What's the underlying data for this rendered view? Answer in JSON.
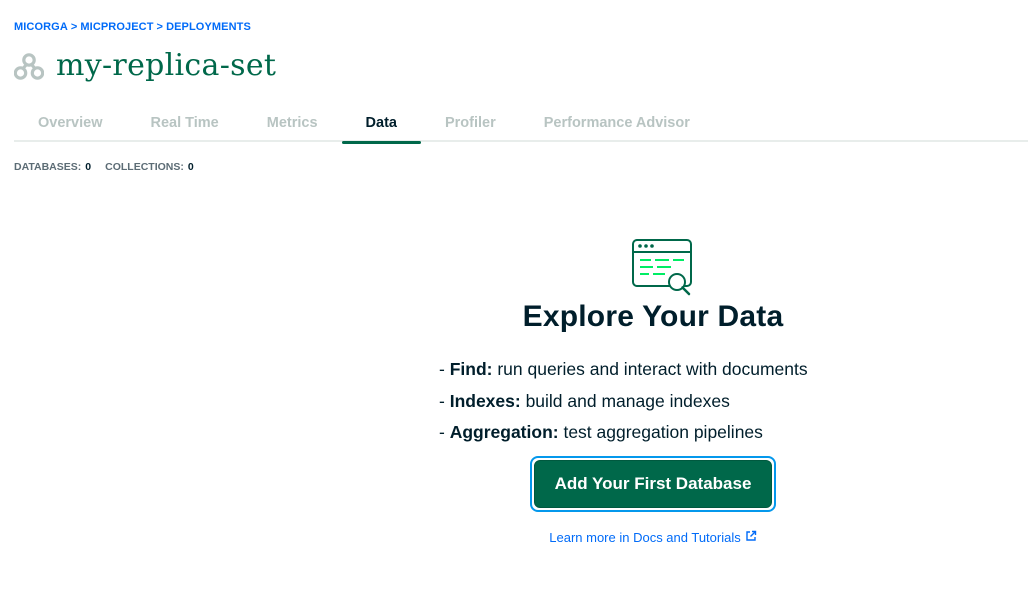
{
  "breadcrumb": {
    "org": "MICORGA",
    "project": "MICPROJECT",
    "section": "DEPLOYMENTS",
    "separator": ">"
  },
  "header": {
    "icon": "replica-set-icon",
    "title": "my-replica-set"
  },
  "tabs": [
    {
      "label": "Overview",
      "active": false
    },
    {
      "label": "Real Time",
      "active": false
    },
    {
      "label": "Metrics",
      "active": false
    },
    {
      "label": "Data",
      "active": true
    },
    {
      "label": "Profiler",
      "active": false
    },
    {
      "label": "Performance Advisor",
      "active": false
    }
  ],
  "stats": {
    "databases_label": "DATABASES:",
    "databases_value": "0",
    "collections_label": "COLLECTIONS:",
    "collections_value": "0"
  },
  "empty_state": {
    "icon": "explore-data-icon",
    "title": "Explore Your Data",
    "features": [
      {
        "prefix": "- ",
        "term": "Find:",
        "desc": " run queries and interact with documents"
      },
      {
        "prefix": "- ",
        "term": "Indexes:",
        "desc": " build and manage indexes"
      },
      {
        "prefix": "- ",
        "term": "Aggregation:",
        "desc": " test aggregation pipelines"
      }
    ],
    "primary_button": "Add Your First Database",
    "docs_link": "Learn more in Docs and Tutorials"
  },
  "colors": {
    "brand_green": "#00684a",
    "link_blue": "#016bf8",
    "focus_ring": "#0498ec"
  }
}
